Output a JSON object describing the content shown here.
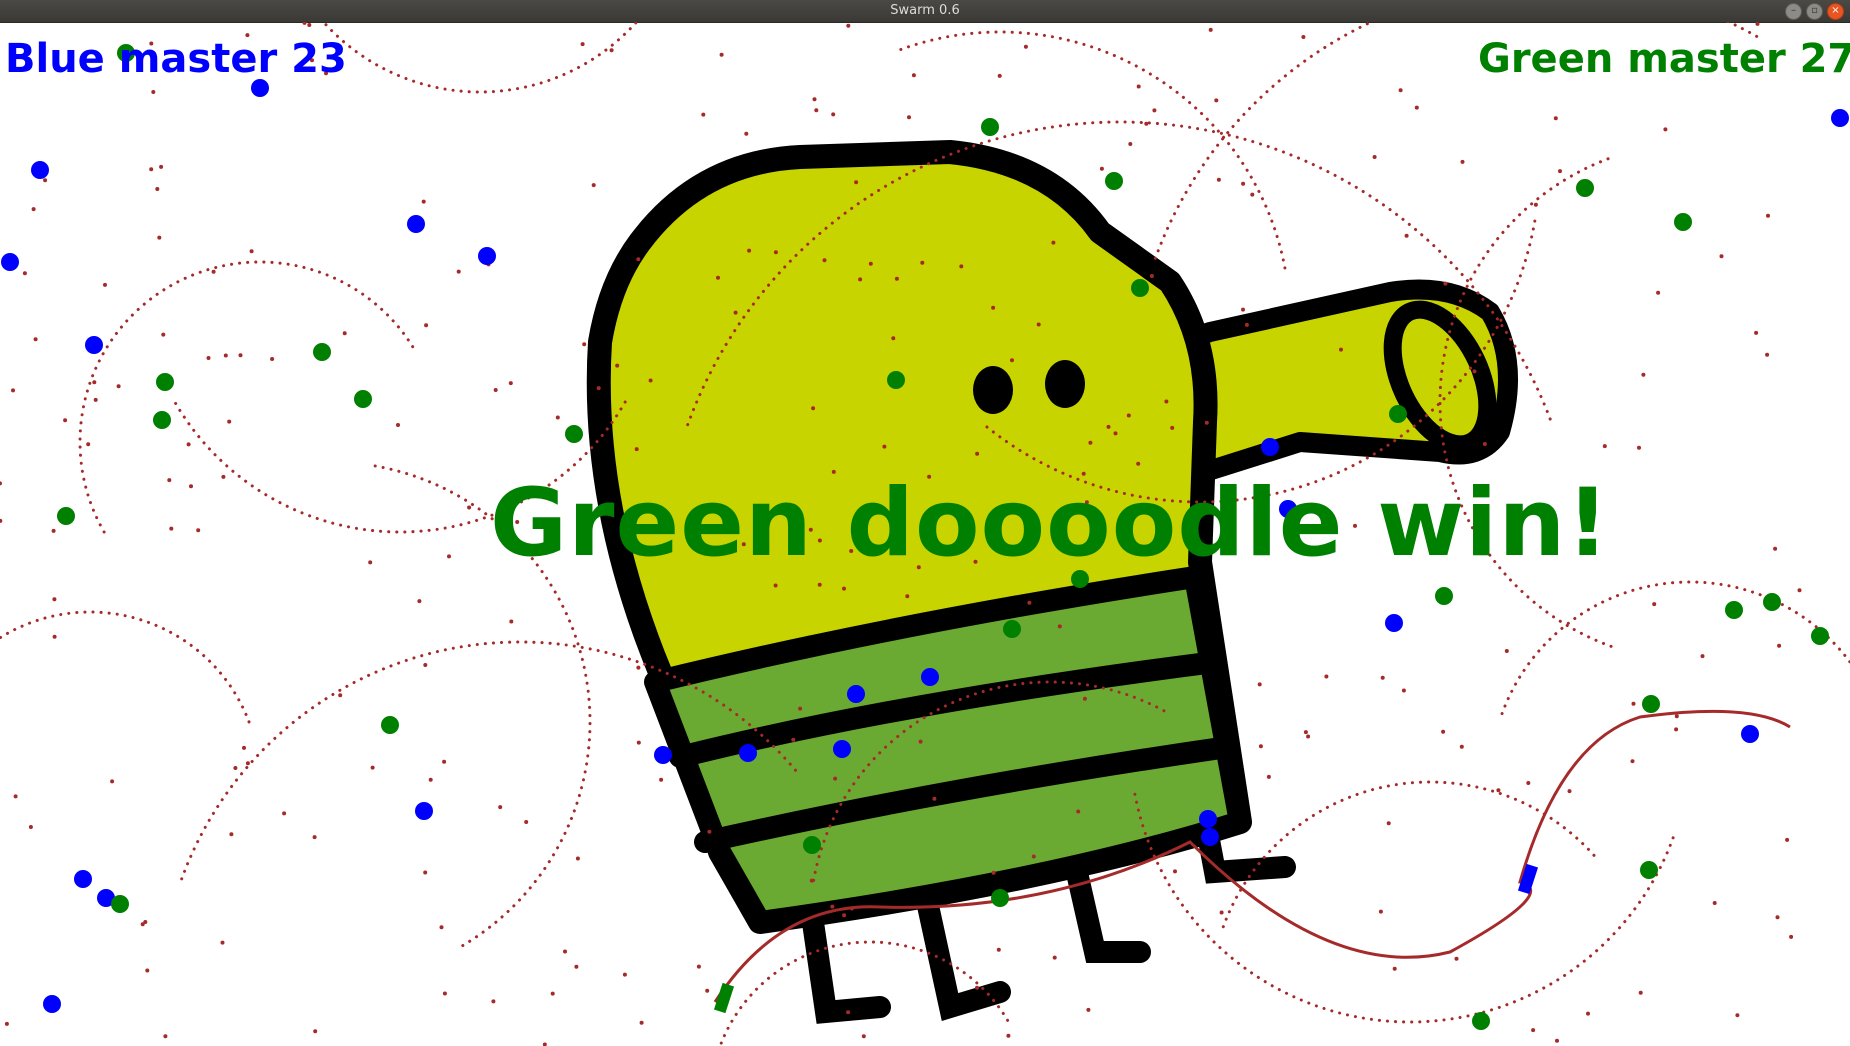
{
  "window": {
    "title": "Swarm 0.6",
    "buttons": [
      "minimize",
      "maximize",
      "close"
    ]
  },
  "hud": {
    "blue_score": "Blue master 23",
    "green_score": "Green master 27"
  },
  "message": "Green doooodle win!",
  "colors": {
    "blue_team": "#0000ff",
    "green_team": "#008000",
    "trail": "#a52a2a",
    "doodle_body": "#c8d400",
    "doodle_stripes": "#6aaa32",
    "outline": "#000000"
  },
  "icons": {
    "background_character": "doodle-jump-character",
    "window_minimize": "minimize-icon",
    "window_maximize": "maximize-icon",
    "window_close": "close-icon"
  }
}
